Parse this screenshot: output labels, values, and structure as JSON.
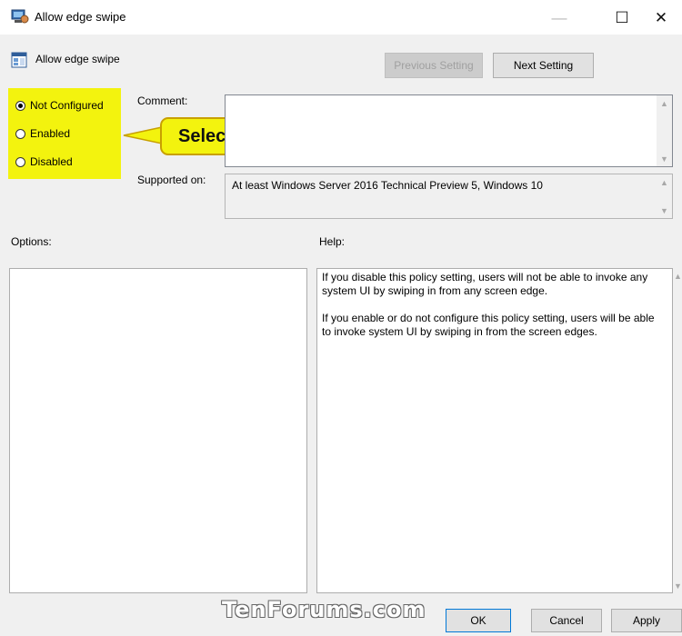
{
  "window": {
    "title": "Allow edge swipe",
    "minimize_glyph": "—",
    "maximize_glyph": "☐",
    "close_glyph": "✕"
  },
  "header": {
    "policy_name": "Allow edge swipe",
    "previous_setting": "Previous Setting",
    "next_setting": "Next Setting"
  },
  "state": {
    "options": [
      {
        "label": "Not Configured",
        "selected": true
      },
      {
        "label": "Enabled",
        "selected": false
      },
      {
        "label": "Disabled",
        "selected": false
      }
    ]
  },
  "comment": {
    "label": "Comment:",
    "value": ""
  },
  "supported": {
    "label": "Supported on:",
    "value": "At least Windows Server 2016 Technical Preview 5, Windows 10"
  },
  "options_label": "Options:",
  "help": {
    "label": "Help:",
    "paragraph1": "If you disable this policy setting, users will not be able to invoke any system UI by swiping in from any screen edge.",
    "paragraph2": "If you enable or do not configure this policy setting, users will be able to invoke system UI by swiping in from the screen edges."
  },
  "callout": {
    "text": "Select"
  },
  "footer": {
    "ok": "OK",
    "cancel": "Cancel",
    "apply": "Apply"
  },
  "watermark": "TenForums.com",
  "colors": {
    "highlight": "#f3f30e",
    "dialog_bg": "#f0f0f0"
  }
}
